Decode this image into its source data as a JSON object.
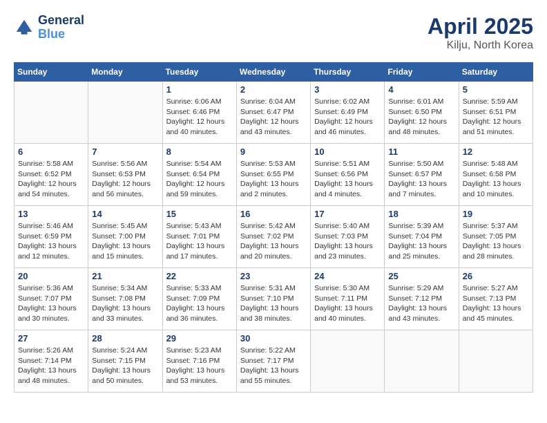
{
  "header": {
    "logo_line1": "General",
    "logo_line2": "Blue",
    "title": "April 2025",
    "location": "Kilju, North Korea"
  },
  "weekdays": [
    "Sunday",
    "Monday",
    "Tuesday",
    "Wednesday",
    "Thursday",
    "Friday",
    "Saturday"
  ],
  "weeks": [
    [
      {
        "day": "",
        "info": ""
      },
      {
        "day": "",
        "info": ""
      },
      {
        "day": "1",
        "info": "Sunrise: 6:06 AM\nSunset: 6:46 PM\nDaylight: 12 hours and 40 minutes."
      },
      {
        "day": "2",
        "info": "Sunrise: 6:04 AM\nSunset: 6:47 PM\nDaylight: 12 hours and 43 minutes."
      },
      {
        "day": "3",
        "info": "Sunrise: 6:02 AM\nSunset: 6:49 PM\nDaylight: 12 hours and 46 minutes."
      },
      {
        "day": "4",
        "info": "Sunrise: 6:01 AM\nSunset: 6:50 PM\nDaylight: 12 hours and 48 minutes."
      },
      {
        "day": "5",
        "info": "Sunrise: 5:59 AM\nSunset: 6:51 PM\nDaylight: 12 hours and 51 minutes."
      }
    ],
    [
      {
        "day": "6",
        "info": "Sunrise: 5:58 AM\nSunset: 6:52 PM\nDaylight: 12 hours and 54 minutes."
      },
      {
        "day": "7",
        "info": "Sunrise: 5:56 AM\nSunset: 6:53 PM\nDaylight: 12 hours and 56 minutes."
      },
      {
        "day": "8",
        "info": "Sunrise: 5:54 AM\nSunset: 6:54 PM\nDaylight: 12 hours and 59 minutes."
      },
      {
        "day": "9",
        "info": "Sunrise: 5:53 AM\nSunset: 6:55 PM\nDaylight: 13 hours and 2 minutes."
      },
      {
        "day": "10",
        "info": "Sunrise: 5:51 AM\nSunset: 6:56 PM\nDaylight: 13 hours and 4 minutes."
      },
      {
        "day": "11",
        "info": "Sunrise: 5:50 AM\nSunset: 6:57 PM\nDaylight: 13 hours and 7 minutes."
      },
      {
        "day": "12",
        "info": "Sunrise: 5:48 AM\nSunset: 6:58 PM\nDaylight: 13 hours and 10 minutes."
      }
    ],
    [
      {
        "day": "13",
        "info": "Sunrise: 5:46 AM\nSunset: 6:59 PM\nDaylight: 13 hours and 12 minutes."
      },
      {
        "day": "14",
        "info": "Sunrise: 5:45 AM\nSunset: 7:00 PM\nDaylight: 13 hours and 15 minutes."
      },
      {
        "day": "15",
        "info": "Sunrise: 5:43 AM\nSunset: 7:01 PM\nDaylight: 13 hours and 17 minutes."
      },
      {
        "day": "16",
        "info": "Sunrise: 5:42 AM\nSunset: 7:02 PM\nDaylight: 13 hours and 20 minutes."
      },
      {
        "day": "17",
        "info": "Sunrise: 5:40 AM\nSunset: 7:03 PM\nDaylight: 13 hours and 23 minutes."
      },
      {
        "day": "18",
        "info": "Sunrise: 5:39 AM\nSunset: 7:04 PM\nDaylight: 13 hours and 25 minutes."
      },
      {
        "day": "19",
        "info": "Sunrise: 5:37 AM\nSunset: 7:05 PM\nDaylight: 13 hours and 28 minutes."
      }
    ],
    [
      {
        "day": "20",
        "info": "Sunrise: 5:36 AM\nSunset: 7:07 PM\nDaylight: 13 hours and 30 minutes."
      },
      {
        "day": "21",
        "info": "Sunrise: 5:34 AM\nSunset: 7:08 PM\nDaylight: 13 hours and 33 minutes."
      },
      {
        "day": "22",
        "info": "Sunrise: 5:33 AM\nSunset: 7:09 PM\nDaylight: 13 hours and 36 minutes."
      },
      {
        "day": "23",
        "info": "Sunrise: 5:31 AM\nSunset: 7:10 PM\nDaylight: 13 hours and 38 minutes."
      },
      {
        "day": "24",
        "info": "Sunrise: 5:30 AM\nSunset: 7:11 PM\nDaylight: 13 hours and 40 minutes."
      },
      {
        "day": "25",
        "info": "Sunrise: 5:29 AM\nSunset: 7:12 PM\nDaylight: 13 hours and 43 minutes."
      },
      {
        "day": "26",
        "info": "Sunrise: 5:27 AM\nSunset: 7:13 PM\nDaylight: 13 hours and 45 minutes."
      }
    ],
    [
      {
        "day": "27",
        "info": "Sunrise: 5:26 AM\nSunset: 7:14 PM\nDaylight: 13 hours and 48 minutes."
      },
      {
        "day": "28",
        "info": "Sunrise: 5:24 AM\nSunset: 7:15 PM\nDaylight: 13 hours and 50 minutes."
      },
      {
        "day": "29",
        "info": "Sunrise: 5:23 AM\nSunset: 7:16 PM\nDaylight: 13 hours and 53 minutes."
      },
      {
        "day": "30",
        "info": "Sunrise: 5:22 AM\nSunset: 7:17 PM\nDaylight: 13 hours and 55 minutes."
      },
      {
        "day": "",
        "info": ""
      },
      {
        "day": "",
        "info": ""
      },
      {
        "day": "",
        "info": ""
      }
    ]
  ]
}
